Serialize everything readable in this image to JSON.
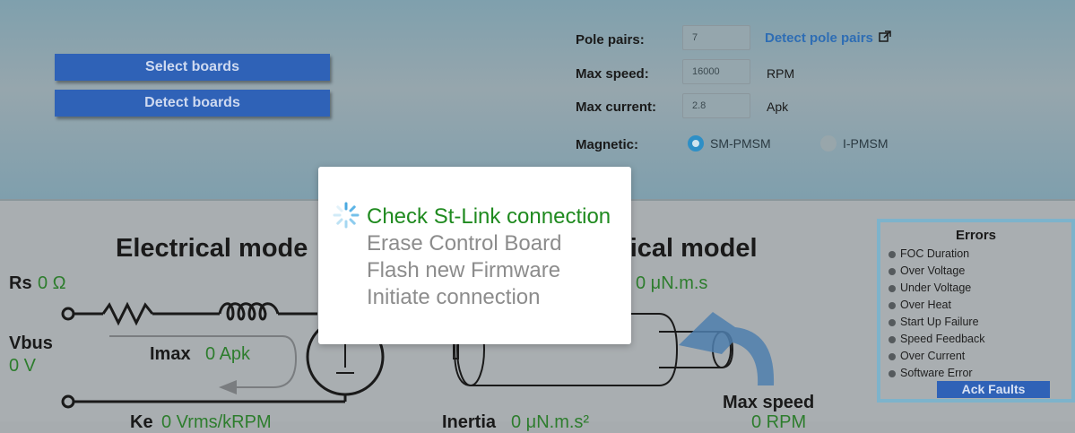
{
  "buttons": {
    "select_boards": "Select boards",
    "detect_boards": "Detect boards"
  },
  "motor_params": {
    "pole_pairs": {
      "label": "Pole pairs:",
      "value": "7"
    },
    "detect_pole_pairs": "Detect pole pairs",
    "max_speed": {
      "label": "Max speed:",
      "value": "16000",
      "unit": "RPM"
    },
    "max_current": {
      "label": "Max current:",
      "value": "2.8",
      "unit": "Apk"
    },
    "magnetic": {
      "label": "Magnetic:",
      "options": [
        {
          "label": "SM-PMSM",
          "selected": true
        },
        {
          "label": "I-PMSM",
          "selected": false
        }
      ]
    }
  },
  "electrical_model": {
    "title": "Electrical mode",
    "rs": {
      "label": "Rs",
      "value": "0 Ω"
    },
    "vbus": {
      "label": "Vbus",
      "value": "0 V"
    },
    "imax": {
      "label": "Imax",
      "value": "0 Apk"
    },
    "ke": {
      "label": "Ke",
      "value": "0 Vrms/kRPM"
    }
  },
  "mechanical_model": {
    "title": "nical model",
    "friction_value": "0 μN.m.s",
    "max_speed": {
      "label": "Max speed",
      "value": "0 RPM"
    },
    "inertia": {
      "label": "Inertia",
      "value": "0 μN.m.s²"
    }
  },
  "errors": {
    "title": "Errors",
    "items": [
      "FOC Duration",
      "Over Voltage",
      "Under Voltage",
      "Over Heat",
      "Start Up Failure",
      "Speed Feedback",
      "Over Current",
      "Software Error"
    ],
    "ack_label": "Ack Faults"
  },
  "modal": {
    "steps": [
      {
        "label": "Check St-Link connection",
        "active": true
      },
      {
        "label": "Erase Control Board",
        "active": false
      },
      {
        "label": "Flash new Firmware",
        "active": false
      },
      {
        "label": "Initiate connection",
        "active": false
      }
    ]
  },
  "colors": {
    "button_blue": "#2f62b7",
    "value_green": "#2d7d2d",
    "active_step_green": "#1f8a1f",
    "link_blue": "#2e6db4",
    "errors_border": "#7db3cb"
  }
}
